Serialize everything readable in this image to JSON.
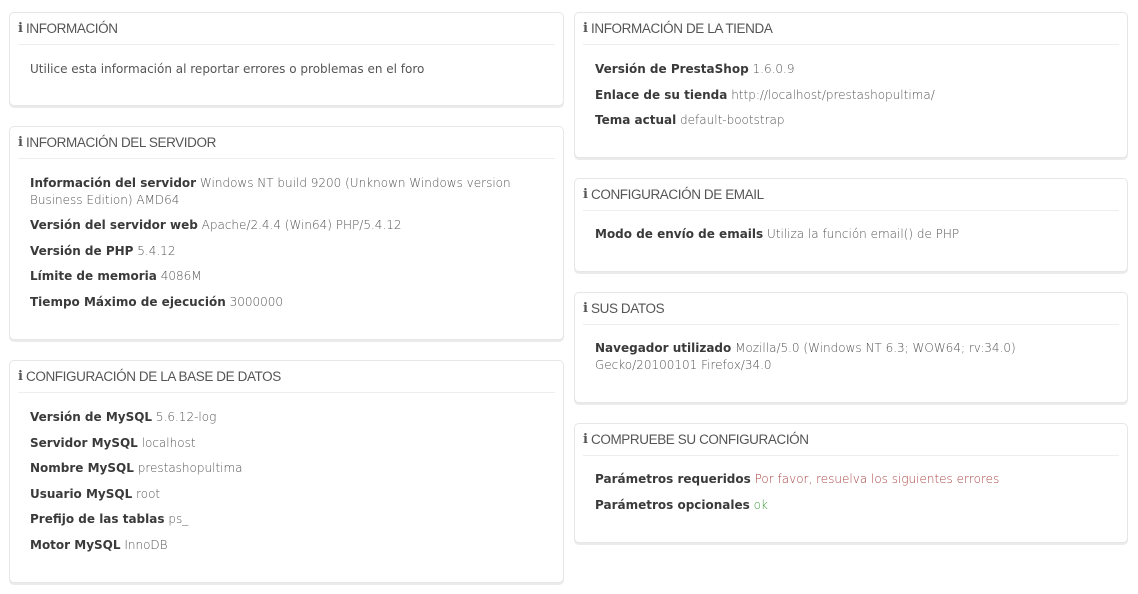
{
  "colors": {
    "error": "#a94442",
    "ok": "#3c9a3c"
  },
  "panels": {
    "informacion": {
      "icon": "info-icon",
      "title": "INFORMACIÓN",
      "text": "Utilice esta información al reportar errores o problemas en el foro"
    },
    "servidor": {
      "icon": "info-icon",
      "title": "INFORMACIÓN DEL SERVIDOR",
      "rows": [
        {
          "label": "Información del servidor",
          "value": "Windows NT build 9200 (Unknown Windows version Business Edition) AMD64"
        },
        {
          "label": "Versión del servidor web",
          "value": "Apache/2.4.4 (Win64) PHP/5.4.12"
        },
        {
          "label": "Versión de PHP",
          "value": "5.4.12"
        },
        {
          "label": "Límite de memoria",
          "value": "4086M"
        },
        {
          "label": "Tiempo Máximo de ejecución",
          "value": "3000000"
        }
      ]
    },
    "base_datos": {
      "icon": "info-icon",
      "title": "CONFIGURACIÓN DE LA BASE DE DATOS",
      "rows": [
        {
          "label": "Versión de MySQL",
          "value": "5.6.12-log"
        },
        {
          "label": "Servidor MySQL",
          "value": "localhost"
        },
        {
          "label": "Nombre MySQL",
          "value": "prestashopultima"
        },
        {
          "label": "Usuario MySQL",
          "value": "root"
        },
        {
          "label": "Prefijo de las tablas",
          "value": "ps_"
        },
        {
          "label": "Motor MySQL",
          "value": "InnoDB"
        }
      ]
    },
    "tienda": {
      "icon": "info-icon",
      "title": "INFORMACIÓN DE LA TIENDA",
      "rows": [
        {
          "label": "Versión de PrestaShop",
          "value": "1.6.0.9"
        },
        {
          "label": "Enlace de su tienda",
          "value": "http://localhost/prestashopultima/"
        },
        {
          "label": "Tema actual",
          "value": "default-bootstrap"
        }
      ]
    },
    "email": {
      "icon": "info-icon",
      "title": "CONFIGURACIÓN DE EMAIL",
      "rows": [
        {
          "label": "Modo de envío de emails",
          "value": "Utiliza la función email() de PHP"
        }
      ]
    },
    "datos": {
      "icon": "info-icon",
      "title": "SUS DATOS",
      "rows": [
        {
          "label": "Navegador utilizado",
          "value": "Mozilla/5.0 (Windows NT 6.3; WOW64; rv:34.0) Gecko/20100101 Firefox/34.0"
        }
      ]
    },
    "comprobar": {
      "icon": "info-icon",
      "title": "COMPRUEBE SU CONFIGURACIÓN",
      "rows": [
        {
          "label": "Parámetros requeridos",
          "value": "Por favor, resuelva los siguientes errores",
          "status": "error"
        },
        {
          "label": "Parámetros opcionales",
          "value": "ok",
          "status": "ok"
        }
      ]
    }
  }
}
